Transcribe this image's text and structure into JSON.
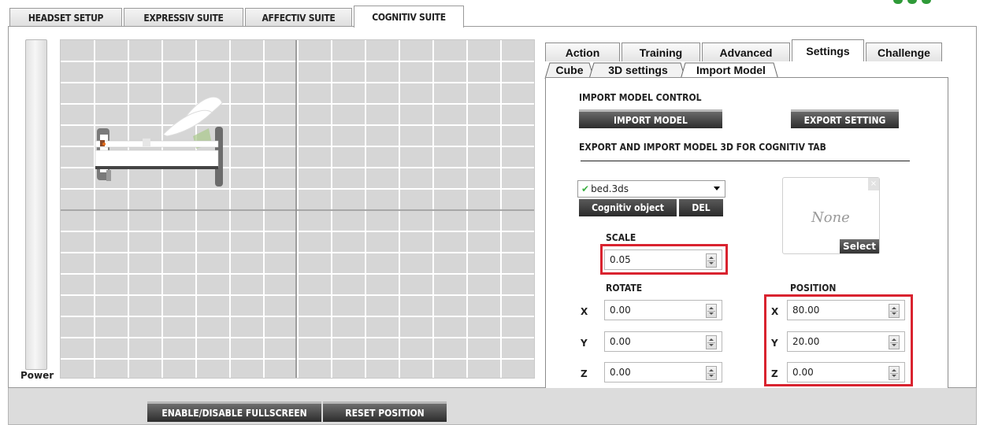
{
  "top_tabs": [
    "HEADSET SETUP",
    "EXPRESSIV SUITE",
    "AFFECTIV SUITE",
    "COGNITIV SUITE"
  ],
  "active_top_tab": "COGNITIV SUITE",
  "power_label": "Power",
  "settings": {
    "tabs": [
      "Action",
      "Training",
      "Advanced",
      "Settings",
      "Challenge"
    ],
    "active_tab": "Settings",
    "subtabs": [
      "Cube",
      "3D settings",
      "Import Model"
    ],
    "active_subtab": "Import Model"
  },
  "import": {
    "control_title": "IMPORT MODEL CONTROL",
    "import_button": "IMPORT MODEL",
    "export_button": "EXPORT SETTING",
    "export_import_title": "EXPORT AND IMPORT MODEL 3D FOR COGNITIV TAB",
    "model_selected": "bed.3ds",
    "cognitiv_object_button": "Cognitiv object",
    "del_button": "DEL",
    "preview_text": "None",
    "preview_close": "×",
    "select_button": "Select",
    "scale_label": "SCALE",
    "scale_value": "0.05",
    "rotate_label": "ROTATE",
    "position_label": "POSITION",
    "rotate": {
      "x": "0.00",
      "y": "0.00",
      "z": "0.00"
    },
    "position": {
      "x": "80.00",
      "y": "20.00",
      "z": "0.00"
    },
    "axes": {
      "x": "X",
      "y": "Y",
      "z": "Z"
    }
  },
  "bottom": {
    "fullscreen_button": "ENABLE/DISABLE FULLSCREEN",
    "reset_button": "RESET POSITION"
  },
  "colors": {
    "highlight": "#d9232f",
    "brand_green": "#2f9a38",
    "button_dark": "#2c2c2c"
  }
}
